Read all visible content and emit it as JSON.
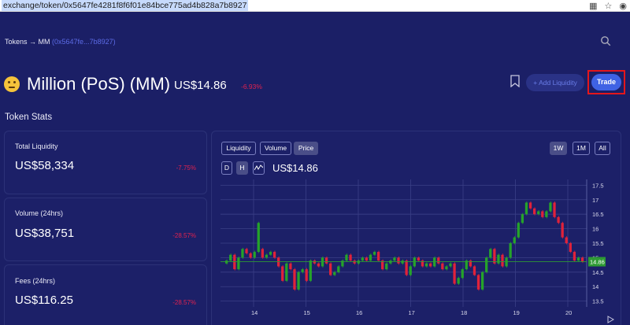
{
  "browser": {
    "url": "exchange/token/0x5647fe4281f8f6f01e84bce775ad4b828a7b8927"
  },
  "header": {
    "breadcrumb_prefix": "Tokens → MM",
    "breadcrumb_address": "(0x5647fe...7b8927)"
  },
  "token": {
    "name": "Million (PoS) (MM)",
    "price": "US$14.86",
    "change": "-6.93%"
  },
  "actions": {
    "add_liquidity": "+ Add Liquidity",
    "trade": "Trade"
  },
  "stats": {
    "title": "Token Stats",
    "cards": [
      {
        "label": "Total Liquidity",
        "value": "US$58,334",
        "change": "-7.75%"
      },
      {
        "label": "Volume (24hrs)",
        "value": "US$38,751",
        "change": "-28.57%"
      },
      {
        "label": "Fees (24hrs)",
        "value": "US$116.25",
        "change": "-28.57%"
      }
    ]
  },
  "chart_controls": {
    "metric_tabs": [
      "Liquidity",
      "Volume",
      "Price"
    ],
    "active_metric": "Price",
    "range_tabs": [
      "1W",
      "1M",
      "All"
    ],
    "active_range": "1W",
    "interval_tabs": [
      "D",
      "H"
    ],
    "active_interval": "H",
    "current_price": "US$14.86"
  },
  "chart_data": {
    "type": "candlestick",
    "x_ticks": [
      "14",
      "15",
      "16",
      "17",
      "18",
      "19",
      "20"
    ],
    "y_ticks": [
      "17.5",
      "17",
      "16.5",
      "16",
      "15.5",
      "15",
      "14.5",
      "14",
      "13.5"
    ],
    "ylim": [
      13.3,
      17.7
    ],
    "last_price_label": "14.86",
    "last_price": 14.86,
    "colors": {
      "up": "#25a32a",
      "down": "#e0223a",
      "last": "#2e9a34"
    },
    "candles": [
      [
        14.8,
        14.9
      ],
      [
        14.9,
        15.1
      ],
      [
        15.1,
        14.6
      ],
      [
        14.6,
        15.0
      ],
      [
        15.0,
        15.3
      ],
      [
        15.3,
        15.15
      ],
      [
        15.15,
        15.0
      ],
      [
        15.0,
        15.2
      ],
      [
        15.2,
        16.2
      ],
      [
        15.3,
        15.0
      ],
      [
        15.0,
        15.1
      ],
      [
        15.1,
        15.2
      ],
      [
        15.2,
        15.0
      ],
      [
        15.0,
        14.7
      ],
      [
        14.7,
        14.2
      ],
      [
        14.2,
        14.8
      ],
      [
        14.8,
        14.6
      ],
      [
        14.6,
        13.9
      ],
      [
        13.9,
        14.5
      ],
      [
        14.5,
        14.6
      ],
      [
        14.6,
        14.2
      ],
      [
        14.2,
        14.9
      ],
      [
        14.9,
        14.8
      ],
      [
        14.8,
        14.7
      ],
      [
        14.7,
        15.0
      ],
      [
        15.0,
        14.8
      ],
      [
        14.8,
        14.4
      ],
      [
        14.4,
        14.5
      ],
      [
        14.5,
        14.7
      ],
      [
        14.7,
        14.9
      ],
      [
        14.9,
        15.1
      ],
      [
        15.1,
        14.9
      ],
      [
        14.9,
        14.8
      ],
      [
        14.8,
        14.9
      ],
      [
        14.9,
        15.0
      ],
      [
        15.0,
        14.9
      ],
      [
        14.9,
        15.1
      ],
      [
        15.1,
        15.2
      ],
      [
        15.2,
        14.9
      ],
      [
        14.9,
        14.6
      ],
      [
        14.6,
        14.8
      ],
      [
        14.8,
        14.9
      ],
      [
        14.9,
        15.0
      ],
      [
        15.0,
        14.8
      ],
      [
        14.8,
        14.9
      ],
      [
        14.9,
        14.4
      ],
      [
        14.4,
        14.7
      ],
      [
        14.7,
        15.0
      ],
      [
        15.0,
        14.9
      ],
      [
        14.9,
        14.7
      ],
      [
        14.7,
        14.8
      ],
      [
        14.8,
        14.7
      ],
      [
        14.7,
        15.0
      ],
      [
        15.0,
        14.8
      ],
      [
        14.8,
        14.6
      ],
      [
        14.6,
        14.7
      ],
      [
        14.7,
        14.8
      ],
      [
        14.8,
        14.1
      ],
      [
        14.1,
        14.3
      ],
      [
        14.3,
        14.6
      ],
      [
        14.6,
        14.9
      ],
      [
        14.9,
        14.7
      ],
      [
        14.7,
        14.4
      ],
      [
        14.4,
        13.9
      ],
      [
        13.9,
        14.5
      ],
      [
        14.5,
        15.0
      ],
      [
        15.0,
        15.3
      ],
      [
        15.3,
        14.8
      ],
      [
        14.8,
        15.1
      ],
      [
        15.1,
        14.7
      ],
      [
        14.7,
        15.0
      ],
      [
        15.0,
        15.5
      ],
      [
        15.5,
        15.7
      ],
      [
        15.7,
        16.2
      ],
      [
        16.2,
        16.5
      ],
      [
        16.5,
        16.9
      ],
      [
        16.9,
        16.7
      ],
      [
        16.7,
        16.5
      ],
      [
        16.5,
        16.6
      ],
      [
        16.6,
        16.4
      ],
      [
        16.4,
        16.6
      ],
      [
        16.6,
        16.9
      ],
      [
        16.9,
        16.4
      ],
      [
        16.4,
        16.2
      ],
      [
        16.2,
        15.7
      ],
      [
        15.7,
        15.5
      ],
      [
        15.5,
        15.2
      ],
      [
        15.2,
        14.9
      ],
      [
        14.9,
        15.0
      ],
      [
        15.0,
        14.86
      ]
    ]
  }
}
